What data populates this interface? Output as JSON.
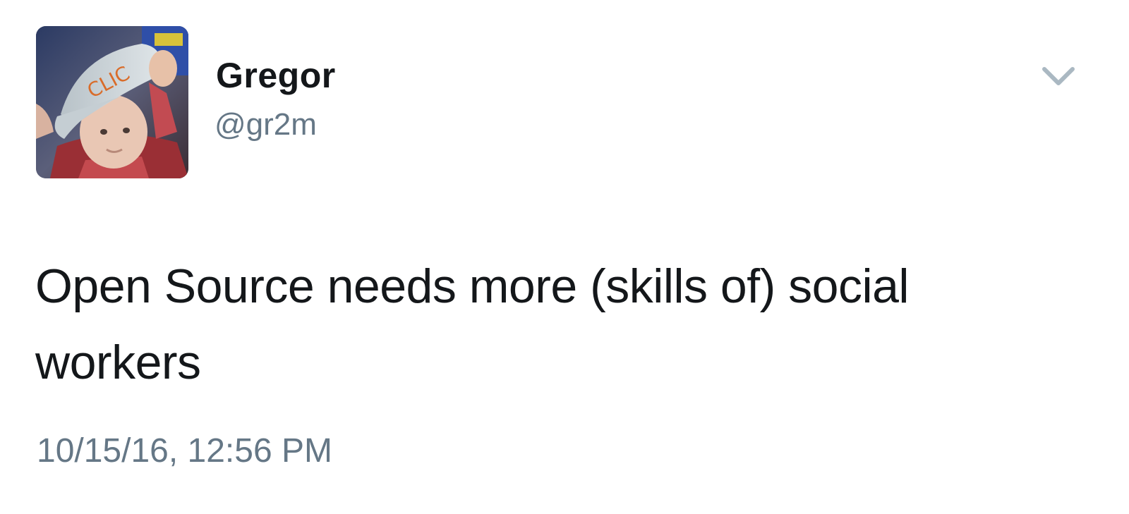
{
  "tweet": {
    "author": {
      "display_name": "Gregor",
      "handle": "@gr2m",
      "avatar_icon": "profile-photo"
    },
    "text": "Open Source needs more (skills of) social workers",
    "timestamp": "10/15/16, 12:56 PM",
    "menu_icon": "chevron-down-icon"
  },
  "colors": {
    "text_primary": "#14171a",
    "text_secondary": "#657786",
    "caret": "#aab8c2"
  }
}
